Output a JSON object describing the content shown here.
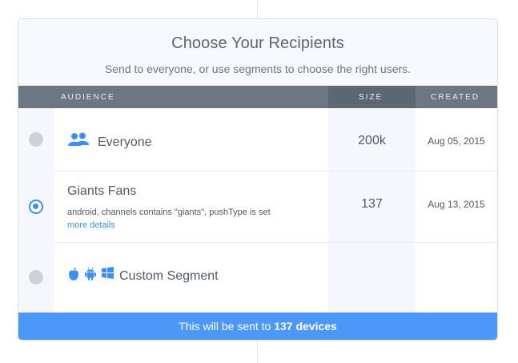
{
  "header": {
    "title": "Choose Your Recipients",
    "subtitle": "Send to everyone, or use segments to choose the right users."
  },
  "table": {
    "columns": {
      "audience": "AUDIENCE",
      "size": "SIZE",
      "created": "CREATED"
    },
    "rows": [
      {
        "name": "Everyone",
        "size": "200k",
        "created": "Aug 05, 2015",
        "selected": false,
        "icon": "users-icon"
      },
      {
        "name": "Giants Fans",
        "description": "android, channels contains \"giants\", pushType is set",
        "link": "more details",
        "size": "137",
        "created": "Aug 13, 2015",
        "selected": true
      },
      {
        "name": "Custom Segment",
        "size": "",
        "created": "",
        "selected": false,
        "icons": [
          "apple-icon",
          "android-icon",
          "windows-icon"
        ]
      }
    ]
  },
  "footer": {
    "prefix": "This will be sent to ",
    "count": "137 devices"
  },
  "colors": {
    "accent": "#3d8ef5",
    "header_bar": "#6d7783",
    "footer": "#4c97f7"
  }
}
